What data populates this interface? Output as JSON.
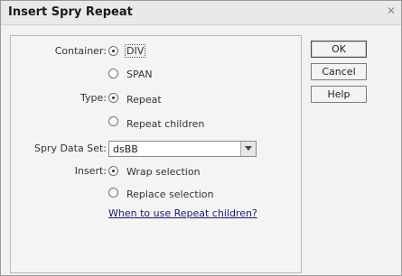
{
  "dialog": {
    "title": "Insert Spry Repeat",
    "close_icon": "close-icon"
  },
  "form": {
    "container_label": "Container:",
    "container_options": [
      "DIV",
      "SPAN"
    ],
    "container_selected": "DIV",
    "type_label": "Type:",
    "type_options": [
      "Repeat",
      "Repeat children"
    ],
    "type_selected": "Repeat",
    "dataset_label": "Spry Data Set:",
    "dataset_value": "dsBB",
    "insert_label": "Insert:",
    "insert_options": [
      "Wrap selection",
      "Replace selection"
    ],
    "insert_selected": "Wrap selection",
    "help_link": "When to use Repeat children?"
  },
  "buttons": {
    "ok": "OK",
    "cancel": "Cancel",
    "help": "Help"
  }
}
